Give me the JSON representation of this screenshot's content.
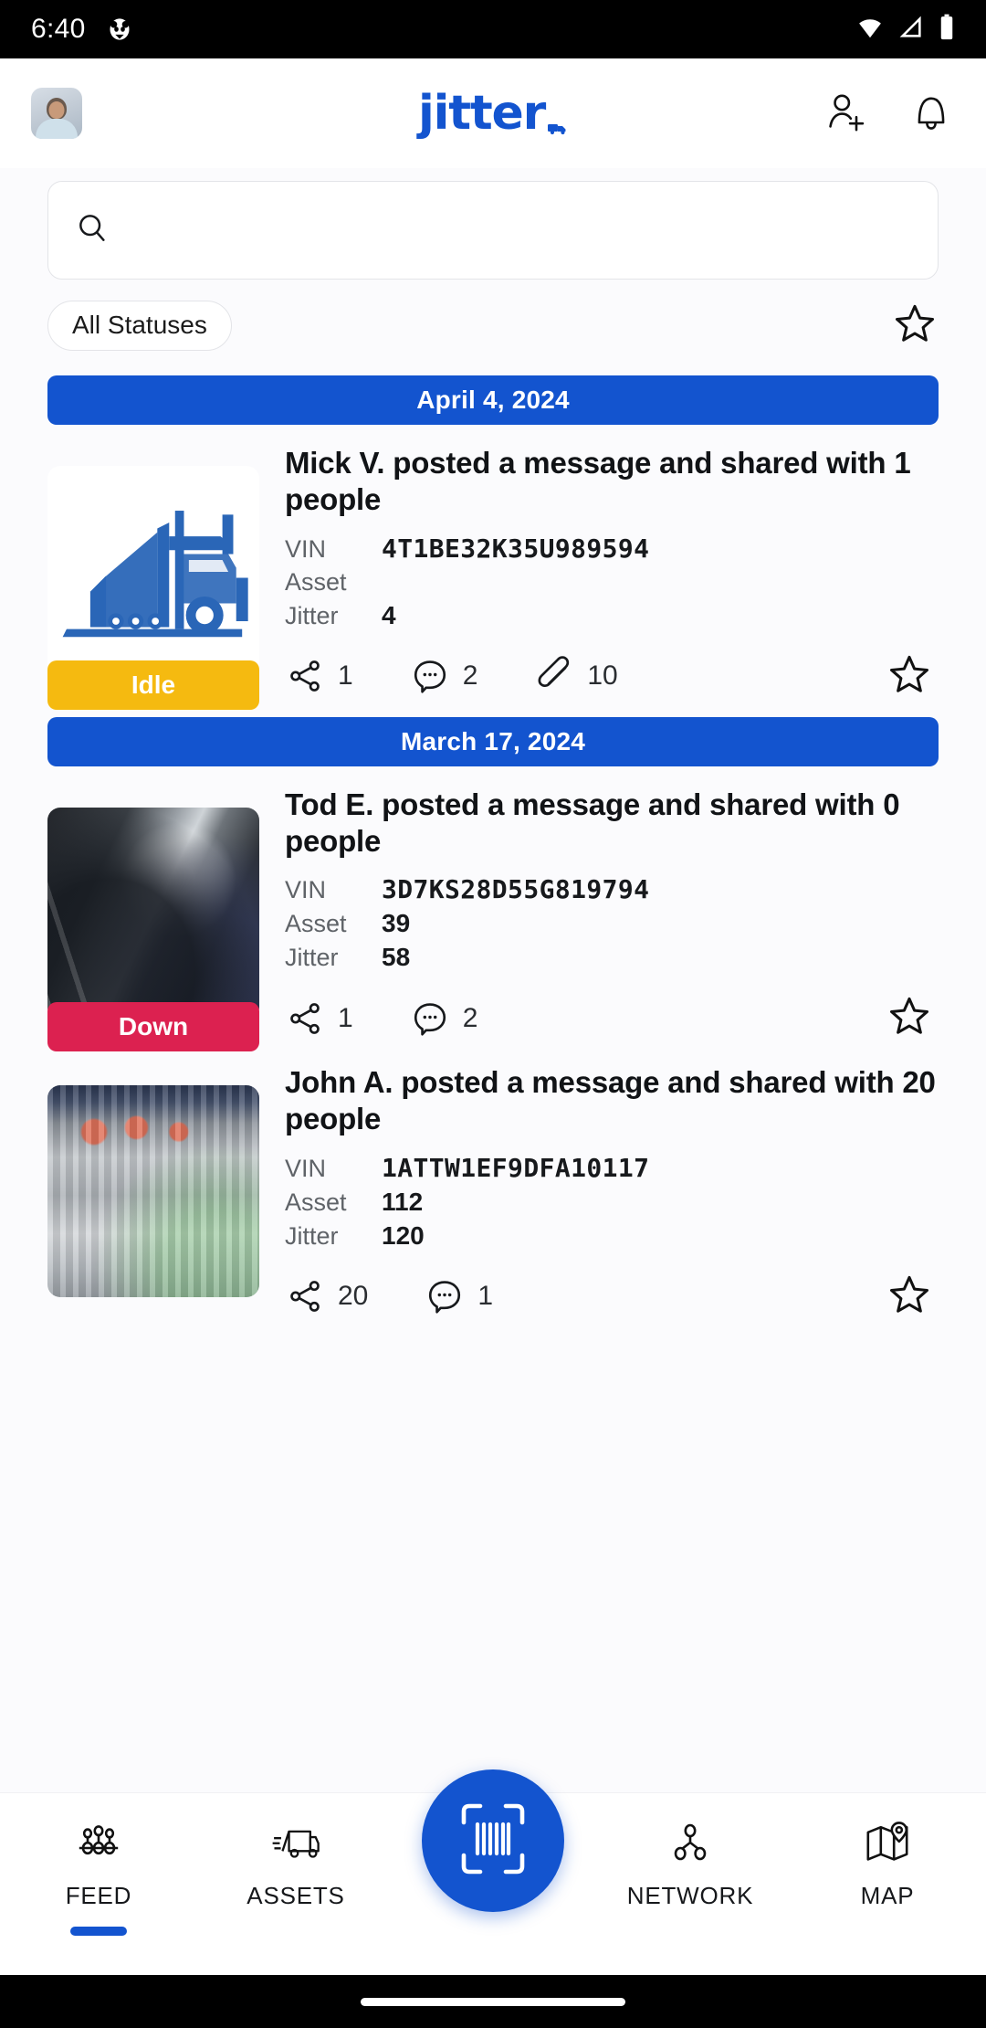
{
  "status_bar": {
    "time": "6:40",
    "app_icon": "panda-notification-icon",
    "wifi_icon": "wifi-icon",
    "signal_icon": "cell-signal-icon",
    "battery_icon": "battery-full-icon"
  },
  "header": {
    "avatar": "user-avatar",
    "logo_text": "jitter",
    "logo_dot_icon": "truck-dot-icon",
    "add_user_icon": "add-user-icon",
    "notifications_icon": "bell-icon"
  },
  "search": {
    "placeholder": "",
    "value": "",
    "icon": "search-icon"
  },
  "filters": {
    "status_chip_label": "All Statuses",
    "favorite_icon": "star-outline-icon"
  },
  "feed": {
    "groups": [
      {
        "date": "April 4, 2024",
        "posts": [
          {
            "title": "Mick  V. posted a message and shared with 1 people",
            "media": "truck-illustration",
            "status_label": "Idle",
            "status_color": "#F5BA10",
            "details": [
              {
                "key": "VIN",
                "value": "4T1BE32K35U989594",
                "mono": true
              },
              {
                "key": "Asset",
                "value": "",
                "mono": false
              },
              {
                "key": "Jitter",
                "value": "4",
                "mono": false
              }
            ],
            "actions": {
              "share_count": "1",
              "comment_count": "2",
              "attachment_count": "10",
              "has_attachments": true,
              "favorite_icon": "star-outline-icon"
            }
          }
        ]
      },
      {
        "date": "March 17, 2024",
        "posts": [
          {
            "title": "Tod E. posted a message and shared with 0 people",
            "media": "exhaust-photo",
            "status_label": "Down",
            "status_color": "#DC2150",
            "details": [
              {
                "key": "VIN",
                "value": "3D7KS28D55G819794",
                "mono": true
              },
              {
                "key": "Asset",
                "value": "39",
                "mono": false
              },
              {
                "key": "Jitter",
                "value": "58",
                "mono": false
              }
            ],
            "actions": {
              "share_count": "1",
              "comment_count": "2",
              "attachment_count": "",
              "has_attachments": false,
              "favorite_icon": "star-outline-icon"
            }
          },
          {
            "title": "John A. posted a message and shared with 20 people",
            "media": "engine-photo",
            "status_label": "",
            "status_color": "#F5BA10",
            "details": [
              {
                "key": "VIN",
                "value": "1ATTW1EF9DFA10117",
                "mono": true
              },
              {
                "key": "Asset",
                "value": "112",
                "mono": false
              },
              {
                "key": "Jitter",
                "value": "120",
                "mono": false
              }
            ],
            "actions": {
              "share_count": "20",
              "comment_count": "1",
              "attachment_count": "",
              "has_attachments": false,
              "favorite_icon": "star-outline-icon"
            }
          }
        ]
      }
    ]
  },
  "bottom_nav": {
    "items": [
      {
        "label": "FEED",
        "icon": "feed-network-icon",
        "active": true
      },
      {
        "label": "ASSETS",
        "icon": "truck-icon",
        "active": false
      },
      {
        "label": "NETWORK",
        "icon": "network-nodes-icon",
        "active": false
      },
      {
        "label": "MAP",
        "icon": "map-pin-icon",
        "active": false
      }
    ],
    "scan_button_icon": "barcode-scan-icon"
  },
  "theme": {
    "brand_blue": "#1354cf",
    "idle_amber": "#F5BA10",
    "down_crimson": "#DC2150"
  }
}
